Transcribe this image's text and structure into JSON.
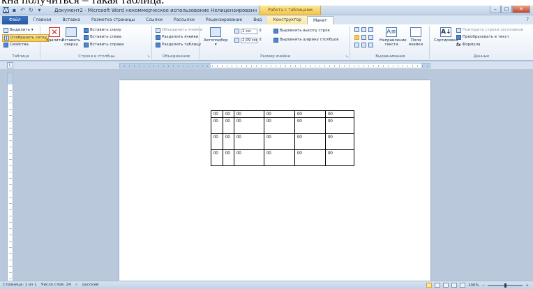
{
  "caption": "кна получиться – такая таблица.",
  "window": {
    "title": "Документ2 - Microsoft Word некоммерческое использование Нелицензированный про...",
    "context_tab_title": "Работа с таблицами"
  },
  "tabs": [
    "Файл",
    "Главная",
    "Вставка",
    "Разметка страницы",
    "Ссылки",
    "Рассылки",
    "Рецензирование",
    "Вид",
    "Конструктор",
    "Макет"
  ],
  "ribbon": {
    "table": {
      "label": "Таблица",
      "select": "Выделить",
      "gridlines": "Отобразить сетку",
      "properties": "Свойства"
    },
    "rows_cols": {
      "label": "Строки и столбцы",
      "delete": "Удалить",
      "insert_above": "Вставить сверху",
      "insert_below": "Вставить снизу",
      "insert_left": "Вставить слева",
      "insert_right": "Вставить справа"
    },
    "merge": {
      "label": "Объединение",
      "merge_cells": "Объединить ячейки",
      "split_cells": "Разделить ячейки",
      "split_table": "Разделить таблицу"
    },
    "cell_size": {
      "label": "Размер ячейки",
      "autofit": "Автоподбор",
      "height_value": "1 см",
      "width_value": "2,09 см",
      "distribute_rows": "Выровнять высоту строк",
      "distribute_cols": "Выровнять ширину столбцов"
    },
    "alignment": {
      "label": "Выравнивание",
      "text_direction": "Направление текста",
      "cell_margins": "Поля ячейки"
    },
    "data": {
      "label": "Данные",
      "sort": "Сортировка",
      "repeat_header": "Повторить строки заголовков",
      "convert": "Преобразовать в текст",
      "formula": "Формула"
    }
  },
  "table_rows": [
    [
      "00",
      "00",
      "00",
      "00",
      "00",
      "00"
    ],
    [
      "00",
      "00",
      "00",
      "00",
      "00",
      "00"
    ],
    [
      "00",
      "00",
      "00",
      "00",
      "00",
      "00"
    ],
    [
      "00",
      "00",
      "00",
      "00",
      "00",
      "00"
    ]
  ],
  "status": {
    "page": "Страница: 1 из 1",
    "words": "Число слов: 24",
    "language": "русский",
    "zoom": "100%"
  }
}
